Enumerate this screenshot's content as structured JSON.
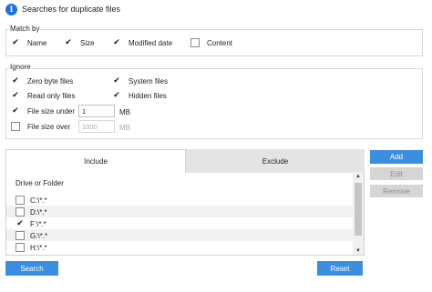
{
  "window": {
    "title": "Searches for duplicate files",
    "icon": "info-icon",
    "accent": "#3c8ee0"
  },
  "match_by": {
    "label": "Match by",
    "options": [
      {
        "label": "Name",
        "checked": true
      },
      {
        "label": "Size",
        "checked": true
      },
      {
        "label": "Modified date",
        "checked": true
      },
      {
        "label": "Content",
        "checked": false
      }
    ]
  },
  "ignore": {
    "label": "Ignore",
    "zero_byte": {
      "label": "Zero byte files",
      "checked": true
    },
    "system": {
      "label": "System files",
      "checked": true
    },
    "read_only": {
      "label": "Read only files",
      "checked": true
    },
    "hidden": {
      "label": "Hidden files",
      "checked": true
    },
    "size_under": {
      "label": "File size under",
      "checked": true,
      "value": "1",
      "unit": "MB"
    },
    "size_over": {
      "label": "File size over",
      "checked": false,
      "value": "1000",
      "unit": "MB"
    }
  },
  "tabs": [
    {
      "label": "Include",
      "active": true
    },
    {
      "label": "Exclude",
      "active": false
    }
  ],
  "list": {
    "header": "Drive or Folder",
    "rows": [
      {
        "label": "C:\\*.*",
        "checked": false
      },
      {
        "label": "D:\\*.*",
        "checked": false
      },
      {
        "label": "F:\\*.*",
        "checked": true
      },
      {
        "label": "G:\\*.*",
        "checked": false
      },
      {
        "label": "H:\\*.*",
        "checked": false
      }
    ]
  },
  "side_buttons": {
    "add": "Add",
    "edit": "Edit",
    "remove": "Remove"
  },
  "footer": {
    "search": "Search",
    "reset": "Reset"
  }
}
